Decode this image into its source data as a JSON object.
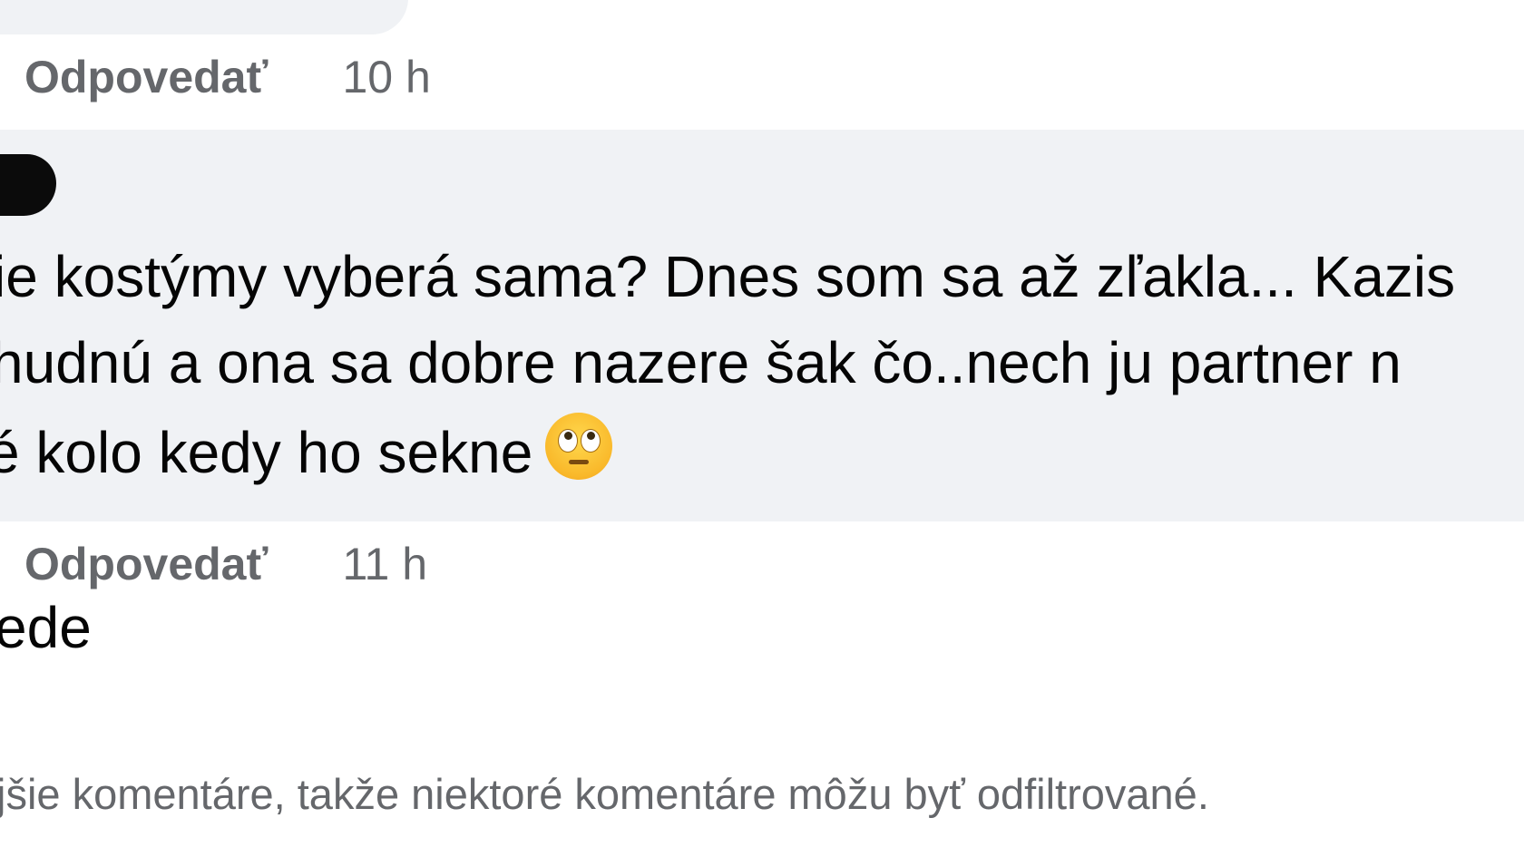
{
  "previous_comment": {
    "reply_label": "Odpovedať",
    "timestamp": "10 h"
  },
  "comment": {
    "lines": [
      "ie kostýmy vyberá sama? Dnes som sa až zľakla... Kazis",
      "hudnú a ona sa dobre nazere šak čo..nech ju partner n",
      "é kolo kedy ho sekne"
    ],
    "emoji_icon": "face-with-rolling-eyes-icon",
    "reply_label": "Odpovedať",
    "timestamp": "11 h"
  },
  "next_comment": {
    "text": "ede"
  },
  "filter_notice": "jšie komentáre, takže niektoré komentáre môžu byť odfiltrované.",
  "colors": {
    "bubble_bg": "#f0f2f5",
    "secondary_text": "#65676b",
    "primary_text": "#050505"
  }
}
